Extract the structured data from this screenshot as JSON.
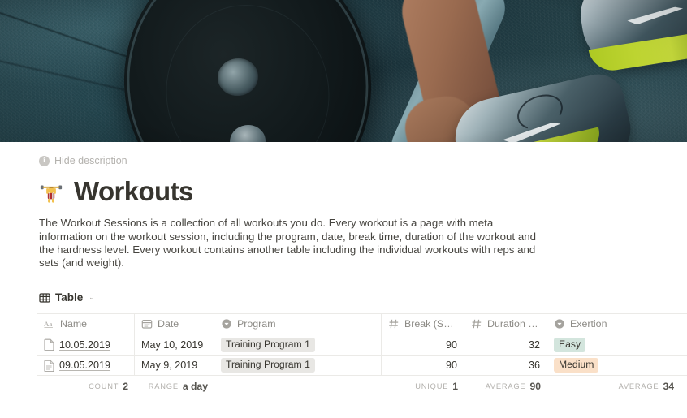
{
  "cover": {
    "alt": "gym floor with barbell plate, hands gripping bar and training shoes"
  },
  "header": {
    "hide_description_label": "Hide description",
    "info_icon_glyph": "i",
    "title": "Workouts",
    "title_emoji": "weightlifter-emoji",
    "description": "The Workout Sessions is a collection of all workouts you do. Every workout is a page with meta information on the workout session, including the program, date, break time, duration of the workout and the hardness level. Every workout contains another table including the individual workouts with reps and sets (and weight)."
  },
  "view": {
    "label": "Table",
    "icon": "table-icon",
    "chevron": "⌄"
  },
  "table": {
    "columns": [
      {
        "label": "Name",
        "icon": "text-type-icon",
        "type": "text"
      },
      {
        "label": "Date",
        "icon": "date-type-icon",
        "type": "date"
      },
      {
        "label": "Program",
        "icon": "select-type-icon",
        "type": "select"
      },
      {
        "label": "Break (Sec.)",
        "icon": "number-type-icon",
        "type": "number"
      },
      {
        "label": "Duration (Mi…",
        "icon": "number-type-icon",
        "type": "number"
      },
      {
        "label": "Exertion",
        "icon": "select-type-icon",
        "type": "select"
      }
    ],
    "rows": [
      {
        "name": "10.05.2019",
        "date": "May 10, 2019",
        "program": "Training Program 1",
        "break": "90",
        "duration": "32",
        "exertion": "Easy",
        "exertion_color": "green"
      },
      {
        "name": "09.05.2019",
        "date": "May 9, 2019",
        "program": "Training Program 1",
        "break": "90",
        "duration": "36",
        "exertion": "Medium",
        "exertion_color": "orange"
      }
    ],
    "summary": [
      {
        "label": "Count",
        "value": "2"
      },
      {
        "label": "Range",
        "value": "a day"
      },
      {
        "label": "",
        "value": ""
      },
      {
        "label": "Unique",
        "value": "1"
      },
      {
        "label": "Average",
        "value": "90"
      },
      {
        "label": "Average",
        "value": "34"
      }
    ]
  },
  "colors": {
    "text": "#37352f",
    "muted": "#8d8b86",
    "border": "#ebeae7",
    "tag_green": "#d3e5dd",
    "tag_orange": "#fae0c8",
    "tag_default": "#e8e7e4"
  }
}
